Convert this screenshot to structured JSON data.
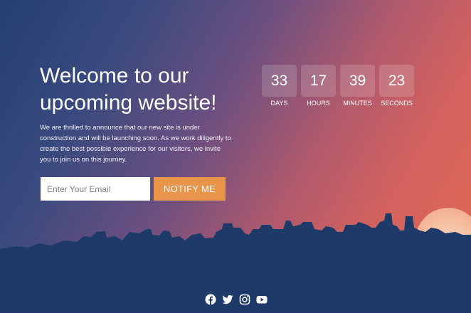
{
  "hero": {
    "headline": "Welcome to our upcoming website!",
    "intro": "We are thrilled to announce that our new site is under construction and will be launching soon. As we work diligently to create the best possible experience for our visitors, we invite you to join us on this journey."
  },
  "signup": {
    "email_placeholder": "Enter Your Email",
    "button_label": "NOTIFY ME"
  },
  "countdown": [
    {
      "value": "33",
      "label": "DAYS"
    },
    {
      "value": "17",
      "label": "HOURS"
    },
    {
      "value": "39",
      "label": "MINUTES"
    },
    {
      "value": "23",
      "label": "SECONDS"
    }
  ],
  "social": {
    "icons": [
      "facebook-icon",
      "twitter-icon",
      "instagram-icon",
      "youtube-icon"
    ]
  },
  "colors": {
    "accent": "#e8944a",
    "skyline": "#1d3a69",
    "gradient_start": "#243f74",
    "gradient_end": "#e06a52"
  }
}
